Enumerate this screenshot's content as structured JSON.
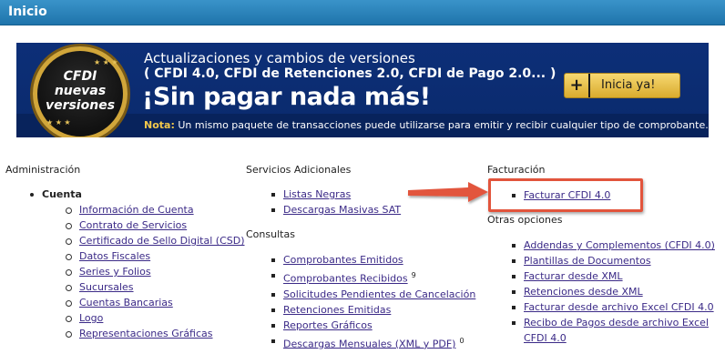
{
  "header": {
    "title": "Inicio"
  },
  "banner": {
    "badge_line1": "CFDI",
    "badge_line2": "nuevas",
    "badge_line3": "versiones",
    "line1": "Actualizaciones y cambios de versiones",
    "line2": "( CFDI 4.0, CFDI de Retenciones 2.0, CFDI de Pago 2.0... )",
    "headline": "¡Sin pagar nada más!",
    "note_label": "Nota:",
    "note_text": " Un mismo paquete de transacciones puede utilizarse para emitir y recibir cualquier tipo de comprobante.",
    "cta_plus": "+",
    "cta_label": "Inicia ya!",
    "accent_gold": "#e6c25a",
    "bg_navy": "#0d2f78"
  },
  "admin": {
    "heading": "Administración",
    "group_label": "Cuenta",
    "items": [
      "Información de Cuenta",
      "Contrato de Servicios",
      "Certificado de Sello Digital (CSD)",
      "Datos Fiscales",
      "Series y Folios",
      "Sucursales",
      "Cuentas Bancarias",
      "Logo",
      "Representaciones Gráficas"
    ]
  },
  "servicios": {
    "heading": "Servicios Adicionales",
    "items": [
      "Listas Negras",
      "Descargas Masivas SAT"
    ]
  },
  "consultas": {
    "heading": "Consultas",
    "items": [
      {
        "label": "Comprobantes Emitidos",
        "badge": ""
      },
      {
        "label": "Comprobantes Recibidos",
        "badge": "9"
      },
      {
        "label": "Solicitudes Pendientes de Cancelación",
        "badge": ""
      },
      {
        "label": "Retenciones Emitidas",
        "badge": ""
      },
      {
        "label": "Reportes Gráficos",
        "badge": ""
      },
      {
        "label": "Descargas Mensuales (XML y PDF)",
        "badge": "0"
      }
    ]
  },
  "facturacion": {
    "heading": "Facturación",
    "items": [
      "Facturar CFDI 4.0"
    ]
  },
  "otras": {
    "heading": "Otras opciones",
    "items": [
      "Addendas y Complementos (CFDI 4.0)",
      "Plantillas de Documentos",
      "Facturar desde XML",
      "Retenciones desde XML",
      "Facturar desde archivo Excel CFDI 4.0",
      "Recibo de Pagos desde archivo Excel",
      "CFDI 4.0"
    ]
  },
  "colors": {
    "link": "#3b2a87",
    "header_blue": "#2b84bd",
    "annotation_red": "#e2543c"
  }
}
